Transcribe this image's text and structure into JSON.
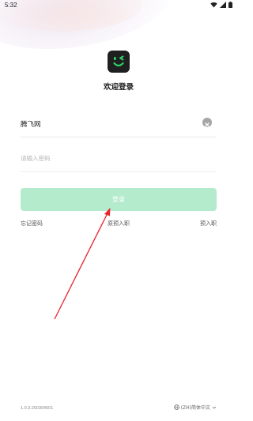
{
  "status_bar": {
    "time": "5:32",
    "icons": [
      "wifi-icon",
      "signal-icon",
      "battery-icon"
    ]
  },
  "header": {
    "logo_icon": "winking-face-icon",
    "title": "欢迎登录"
  },
  "form": {
    "username_value": "腾飞网",
    "clear_icon": "clear-icon",
    "password_placeholder": "请输入密码",
    "login_label": "登录"
  },
  "links": {
    "forgot": "忘记密码",
    "original": "原预入职",
    "pre": "预入职"
  },
  "footer": {
    "version": "1.0.3.250304001",
    "language": "(ZH)简体中文",
    "globe_icon": "globe-icon",
    "chevron_icon": "chevron-down-icon"
  },
  "annotation": {
    "arrow_color": "#e8262f"
  },
  "colors": {
    "login_button": "#b4ebcd",
    "logo_bg": "#1f1f1f",
    "logo_accent": "#2bd46b",
    "clear_button": "#a6a6a6"
  }
}
